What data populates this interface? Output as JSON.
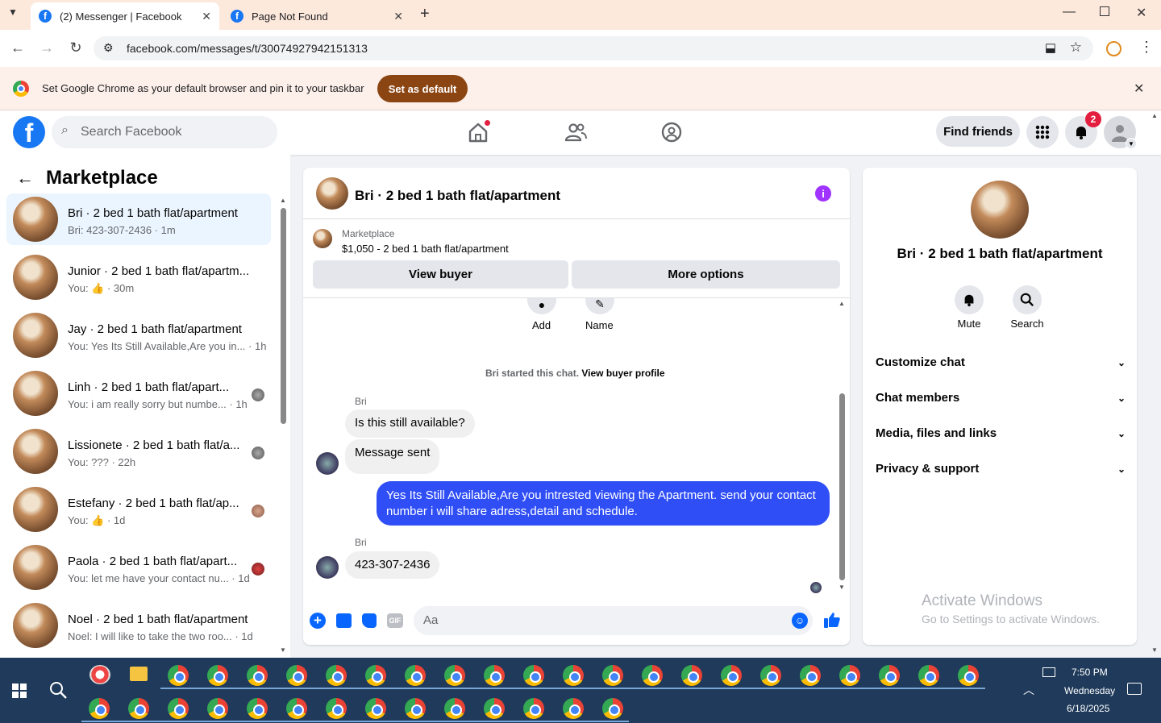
{
  "browser": {
    "tabs": [
      {
        "title": "(2) Messenger | Facebook"
      },
      {
        "title": "Page Not Found"
      }
    ],
    "url": "facebook.com/messages/t/30074927942151313",
    "infobar": {
      "text": "Set Google Chrome as your default browser and pin it to your taskbar",
      "button": "Set as default"
    }
  },
  "fb": {
    "search_placeholder": "Search Facebook",
    "find_friends": "Find friends",
    "notif_count": "2"
  },
  "sidebar": {
    "title": "Marketplace",
    "conversations": [
      {
        "name": "Bri · 2 bed 1 bath flat/apartment",
        "preview": "Bri: 423-307-2436 · 1m"
      },
      {
        "name": "Junior · 2 bed 1 bath flat/apartm...",
        "preview": "You: 👍 · 30m"
      },
      {
        "name": "Jay · 2 bed 1 bath flat/apartment",
        "preview": "You: Yes Its Still Available,Are you in... · 1h"
      },
      {
        "name": "Linh · 2 bed 1 bath flat/apart...",
        "preview": "You: i am really sorry but numbe... · 1h"
      },
      {
        "name": "Lissionete · 2 bed 1 bath flat/a...",
        "preview": "You: ??? · 22h"
      },
      {
        "name": "Estefany · 2 bed 1 bath flat/ap...",
        "preview": "You: 👍 · 1d"
      },
      {
        "name": "Paola · 2 bed 1 bath flat/apart...",
        "preview": "You: let me have your contact nu... · 1d"
      },
      {
        "name": "Noel · 2 bed 1 bath flat/apartment",
        "preview": "Noel: I will like to take the two roo... · 1d"
      }
    ]
  },
  "chat": {
    "title": "Bri · 2 bed 1 bath flat/apartment",
    "listing_source": "Marketplace",
    "listing": "$1,050 - 2 bed 1 bath flat/apartment",
    "view_buyer": "View buyer",
    "more_options": "More options",
    "add_label": "Add",
    "name_label": "Name",
    "started_text": "Bri started this chat.",
    "view_profile": "View buyer profile",
    "sender": "Bri",
    "msg1": "Is this still available?",
    "msg2": "Message sent",
    "msg3": "Yes Its Still Available,Are you intrested viewing the Apartment. send your contact number i will share adress,detail and schedule.",
    "msg4": "423-307-2436",
    "composer_placeholder": "Aa"
  },
  "details": {
    "title": "Bri · 2 bed 1 bath flat/apartment",
    "mute": "Mute",
    "search": "Search",
    "sections": [
      "Customize chat",
      "Chat members",
      "Media, files and links",
      "Privacy & support"
    ],
    "watermark_title": "Activate Windows",
    "watermark_sub": "Go to Settings to activate Windows."
  },
  "taskbar": {
    "time": "7:50 PM",
    "day": "Wednesday",
    "date": "6/18/2025"
  },
  "colors": {
    "fb_blue": "#1877f2",
    "my_bubble": "#2f4ef5"
  }
}
